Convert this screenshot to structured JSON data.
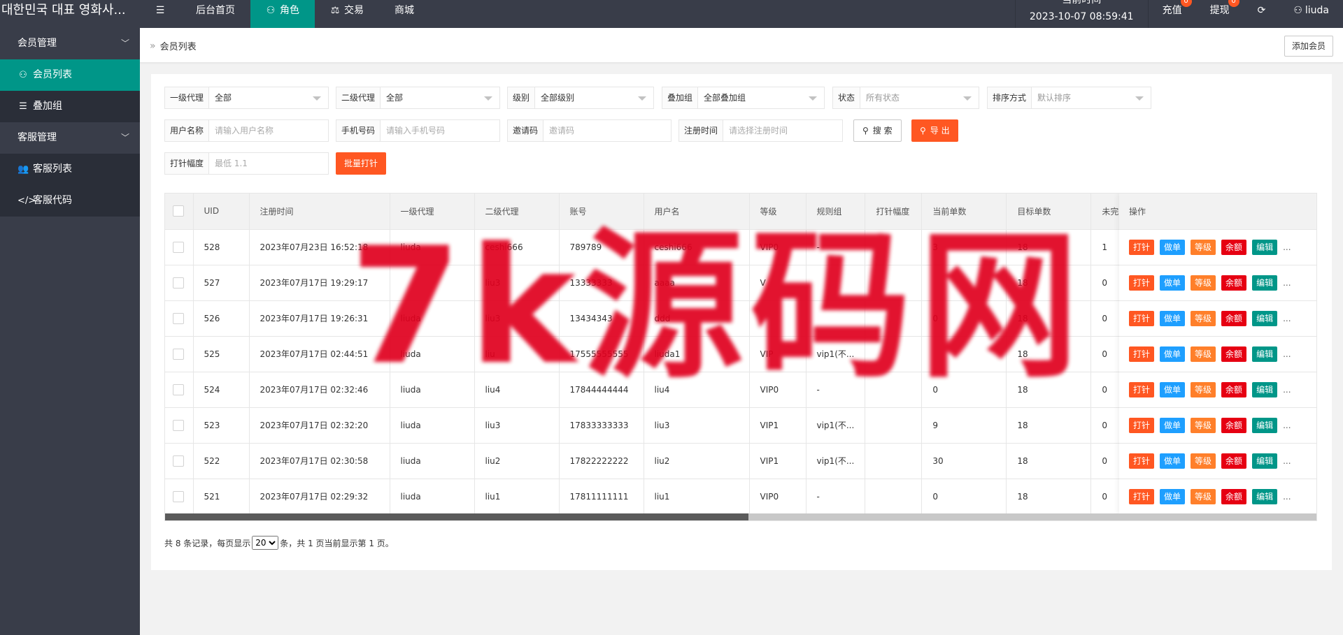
{
  "app": {
    "title": "대한민국 대표 영화사..."
  },
  "topnav": [
    {
      "label": "后台首页",
      "icon": "",
      "active": false
    },
    {
      "label": "角色",
      "icon": "user-icon",
      "active": true
    },
    {
      "label": "交易",
      "icon": "scale-icon",
      "active": false
    },
    {
      "label": "商城",
      "icon": "",
      "active": false
    }
  ],
  "topright": {
    "time_label": "当前时间",
    "time_value": "2023-10-07 08:59:41",
    "recharge": "充值",
    "recharge_badge": "0",
    "withdraw": "提现",
    "withdraw_badge": "0",
    "user": "liuda"
  },
  "sidebar": {
    "group1": "会员管理",
    "item_members": "会员列表",
    "item_stack": "叠加组",
    "group2": "客服管理",
    "item_cs_list": "客服列表",
    "item_cs_code": "客服代码"
  },
  "breadcrumb": {
    "current": "会员列表",
    "add_button": "添加会员"
  },
  "filters": {
    "agent1_label": "一级代理",
    "agent1_value": "全部",
    "agent2_label": "二级代理",
    "agent2_value": "全部",
    "level_label": "级别",
    "level_value": "全部级别",
    "stack_label": "叠加组",
    "stack_value": "全部叠加组",
    "status_label": "状态",
    "status_value": "所有状态",
    "sort_label": "排序方式",
    "sort_value": "默认排序",
    "username_label": "用户名称",
    "username_placeholder": "请输入用户名称",
    "phone_label": "手机号码",
    "phone_placeholder": "请输入手机号码",
    "invite_label": "邀请码",
    "invite_placeholder": "邀请码",
    "regtime_label": "注册时间",
    "regtime_placeholder": "请选择注册时间",
    "search_button": "搜 索",
    "export_button": "导 出",
    "range_label": "打针幅度",
    "range_placeholder": "最低 1.1",
    "batch_button": "批量打针"
  },
  "table": {
    "headers": [
      "UID",
      "注册时间",
      "一级代理",
      "二级代理",
      "账号",
      "用户名",
      "等级",
      "规则组",
      "打针幅度",
      "当前单数",
      "目标单数",
      "未完成"
    ],
    "op_header": "操作",
    "rows": [
      [
        "528",
        "2023年07月23日 16:52:18",
        "liuda",
        "ceshi666",
        "789789",
        "ceshi666",
        "VIP0",
        "-",
        "",
        "3",
        "18",
        "1"
      ],
      [
        "527",
        "2023年07月17日 19:29:17",
        "",
        "liu3",
        "13333333",
        "aaaa",
        "V",
        "",
        "",
        "",
        "18",
        "0"
      ],
      [
        "526",
        "2023年07月17日 19:26:31",
        "liuda",
        "liu3",
        "13434343",
        "ddd",
        "",
        "",
        "",
        "0",
        "18",
        "0"
      ],
      [
        "525",
        "2023年07月17日 02:44:51",
        "liuda",
        "liu",
        "17555555555",
        "liuda1",
        "VIP",
        "vip1(不...",
        "",
        "",
        "18",
        "0"
      ],
      [
        "524",
        "2023年07月17日 02:32:46",
        "liuda",
        "liu4",
        "17844444444",
        "liu4",
        "VIP0",
        "-",
        "",
        "0",
        "18",
        "0"
      ],
      [
        "523",
        "2023年07月17日 02:32:20",
        "liuda",
        "liu3",
        "17833333333",
        "liu3",
        "VIP1",
        "vip1(不...",
        "",
        "9",
        "18",
        "0"
      ],
      [
        "522",
        "2023年07月17日 02:30:58",
        "liuda",
        "liu2",
        "17822222222",
        "liu2",
        "VIP1",
        "vip1(不...",
        "",
        "30",
        "18",
        "0"
      ],
      [
        "521",
        "2023年07月17日 02:29:32",
        "liuda",
        "liu1",
        "17811111111",
        "liu1",
        "VIP0",
        "-",
        "",
        "0",
        "18",
        "0"
      ]
    ],
    "ops": [
      "打针",
      "做单",
      "等级",
      "余额",
      "编辑"
    ],
    "more": "..."
  },
  "pager": {
    "prefix": "共 8 条记录，每页显示",
    "page_size": "20",
    "suffix": "条，共 1 页当前显示第 1 页。"
  },
  "watermark": "7k源码网",
  "colors": {
    "topbar": "#393d49",
    "accent": "#009688",
    "orange": "#ff5722",
    "blue": "#1e9fff",
    "red": "#e60012"
  }
}
